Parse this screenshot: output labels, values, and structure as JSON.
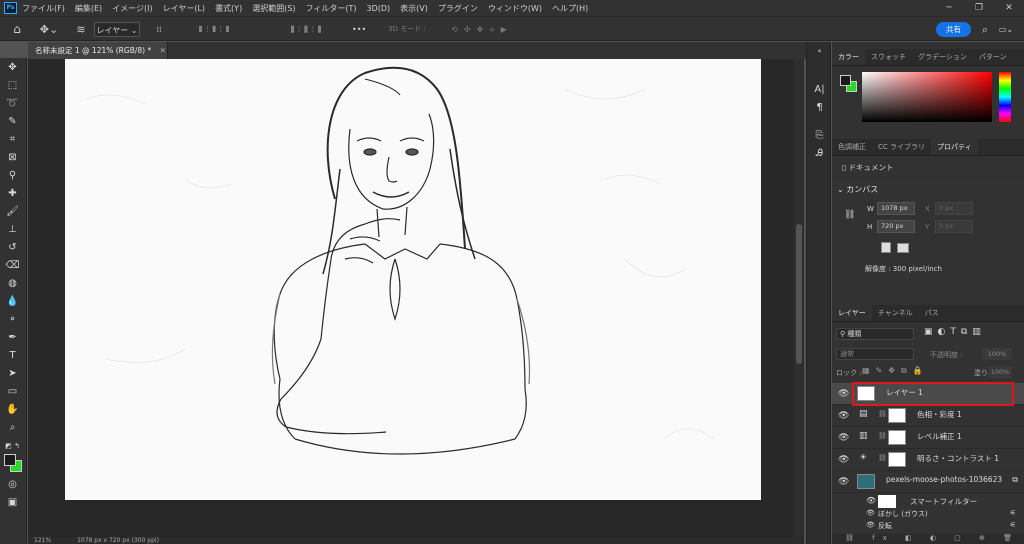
{
  "app": {
    "logo": "Ps"
  },
  "menu": [
    "ファイル(F)",
    "編集(E)",
    "イメージ(I)",
    "レイヤー(L)",
    "書式(Y)",
    "選択範囲(S)",
    "フィルター(T)",
    "3D(D)",
    "表示(V)",
    "プラグイン",
    "ウィンドウ(W)",
    "ヘルプ(H)"
  ],
  "window_controls": {
    "minimize": "─",
    "restore": "❐",
    "close": "✕"
  },
  "options_bar": {
    "layer_select": "レイヤー",
    "mode_3d": "3D モード :",
    "share": "共有"
  },
  "document_tab": {
    "title": "名称未設定 1 @ 121% (RGB/8) *",
    "close": "✕"
  },
  "status_bar": {
    "zoom": "121%",
    "dimensions": "1078 px x 720 px (300 ppi)"
  },
  "color_panel": {
    "tabs": [
      "カラー",
      "スウォッチ",
      "グラデーション",
      "パターン"
    ],
    "foreground": "#1a1a1a",
    "background": "#22dd22"
  },
  "properties_panel": {
    "tabs": [
      "色調補正",
      "CC ライブラリ",
      "プロパティ"
    ],
    "doc_label": "ドキュメント",
    "section": "カンバス",
    "w_label": "W",
    "w_value": "1078 px",
    "h_label": "H",
    "h_value": "720 px",
    "x_label": "X",
    "x_placeholder": "0 px",
    "y_label": "Y",
    "y_placeholder": "0 px",
    "resolution": "解像度 : 300 pixel/inch"
  },
  "layers_panel": {
    "tabs": [
      "レイヤー",
      "チャンネル",
      "パス"
    ],
    "filter_label": "種類",
    "blend_mode": "通常",
    "opacity_label": "不透明度 :",
    "opacity_value": "100%",
    "lock_label": "ロック :",
    "fill_label": "塗り :",
    "fill_value": "100%",
    "layers": [
      {
        "name": "レイヤー 1",
        "selected": true
      },
      {
        "name": "色相・彩度 1"
      },
      {
        "name": "レベル補正 1"
      },
      {
        "name": "明るさ・コントラスト 1"
      },
      {
        "name": "pexels-moose-photos-1036623"
      }
    ],
    "smart_filter": "スマートフィルター",
    "filters": [
      "ぼかし (ガウス)",
      "反転"
    ]
  }
}
